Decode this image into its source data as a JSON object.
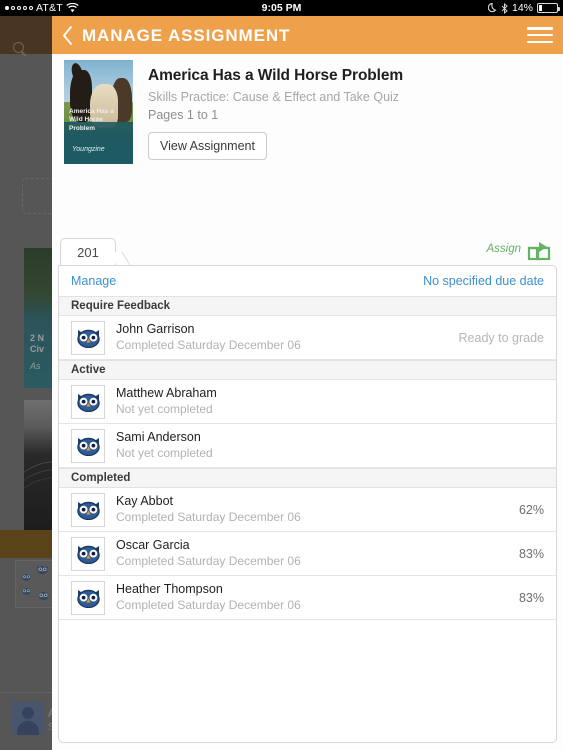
{
  "status_bar": {
    "carrier": "AT&T",
    "signal_dots_filled": 1,
    "signal_dots_total": 5,
    "wifi_icon": "wifi-icon",
    "time": "9:05 PM",
    "moon_icon": "moon-icon",
    "bluetooth_icon": "bluetooth-icon",
    "battery_percent": "14%"
  },
  "nav": {
    "back_icon": "chevron-left-icon",
    "title": "MANAGE ASSIGNMENT",
    "menu_icon": "hamburger-menu-icon",
    "bg_color": "#efa04a"
  },
  "background": {
    "search_icon": "search-icon",
    "card_1_title": "2 N\nCiv",
    "card_1_sub": "As",
    "user_name": "A",
    "user_sub": "S"
  },
  "assignment": {
    "cover": {
      "title": "America Has a Wild Horse Problem",
      "brand": "Youngzine",
      "image": "two-horses-in-field-photo"
    },
    "title": "America Has a Wild Horse Problem",
    "subtitle": "Skills Practice: Cause & Effect and Take Quiz",
    "pages": "Pages 1 to 1",
    "view_button": "View Assignment"
  },
  "tabs": {
    "items": [
      {
        "label": "201",
        "active": true
      }
    ],
    "assign_label": "Assign",
    "share_icon": "share-export-icon",
    "accent_color": "#63b363"
  },
  "panel": {
    "manage_label": "Manage",
    "due_label": "No specified due date",
    "link_color": "#3d8fd0",
    "sections": [
      {
        "heading": "Require Feedback",
        "rows": [
          {
            "avatar": "owl-avatar",
            "name": "John Garrison",
            "subtitle": "Completed Saturday December 06",
            "right": "Ready to grade",
            "right_kind": "status"
          }
        ]
      },
      {
        "heading": "Active",
        "rows": [
          {
            "avatar": "owl-avatar",
            "name": "Matthew Abraham",
            "subtitle": "Not yet completed",
            "right": "",
            "right_kind": "status"
          },
          {
            "avatar": "owl-avatar",
            "name": "Sami Anderson",
            "subtitle": "Not yet completed",
            "right": "",
            "right_kind": "status"
          }
        ]
      },
      {
        "heading": "Completed",
        "rows": [
          {
            "avatar": "owl-avatar",
            "name": "Kay Abbot",
            "subtitle": "Completed Saturday December 06",
            "right": "62%",
            "right_kind": "score"
          },
          {
            "avatar": "owl-avatar",
            "name": "Oscar Garcia",
            "subtitle": "Completed Saturday December 06",
            "right": "83%",
            "right_kind": "score"
          },
          {
            "avatar": "owl-avatar",
            "name": "Heather Thompson",
            "subtitle": "Completed Saturday December 06",
            "right": "83%",
            "right_kind": "score"
          }
        ]
      }
    ]
  }
}
